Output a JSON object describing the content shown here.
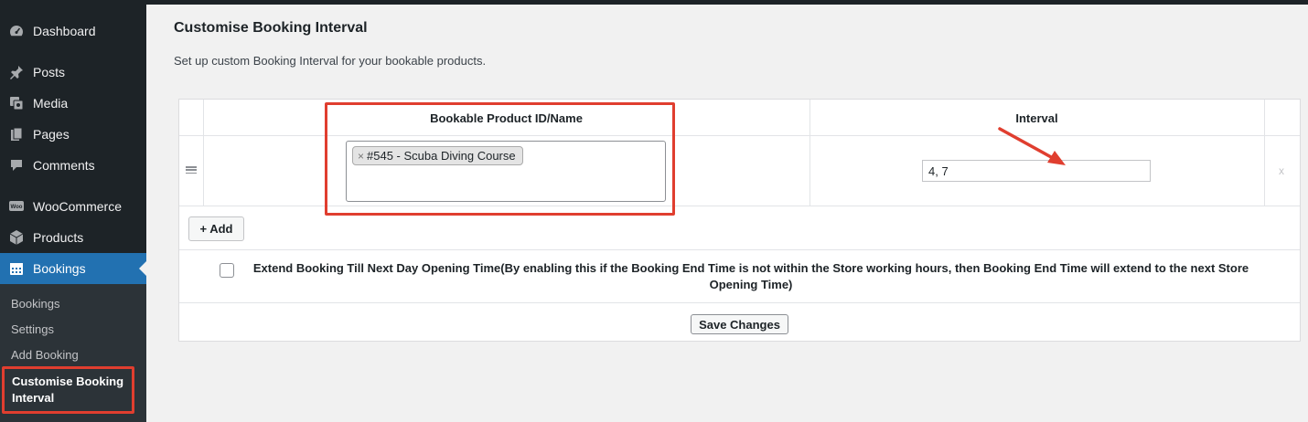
{
  "sidebar": {
    "items": [
      {
        "label": "Dashboard",
        "icon": "dashboard-icon"
      },
      {
        "label": "Posts",
        "icon": "pin-icon"
      },
      {
        "label": "Media",
        "icon": "media-icon"
      },
      {
        "label": "Pages",
        "icon": "pages-icon"
      },
      {
        "label": "Comments",
        "icon": "comment-icon"
      },
      {
        "label": "WooCommerce",
        "icon": "woocommerce-icon"
      },
      {
        "label": "Products",
        "icon": "box-icon"
      },
      {
        "label": "Bookings",
        "icon": "calendar-icon"
      }
    ],
    "submenu": [
      "Bookings",
      "Settings",
      "Add Booking",
      "Customise Booking Interval"
    ],
    "active_color": "#2271b1",
    "highlight_color": "#e03e2f"
  },
  "page": {
    "title": "Customise Booking Interval",
    "description": "Set up custom Booking Interval for your bookable products."
  },
  "table": {
    "columns": [
      "Bookable Product ID/Name",
      "Interval"
    ],
    "rows": [
      {
        "product_chip": "#545 - Scuba Diving Course",
        "chip_remove": "×",
        "interval": "4, 7",
        "remove": "x"
      }
    ]
  },
  "actions": {
    "add_label": "+ Add",
    "extend_label": "Extend Booking Till Next Day Opening Time(By enabling this if the Booking End Time is not within the Store working hours, then Booking End Time will extend to the next Store Opening Time)",
    "extend_checked": false,
    "save_label": "Save Changes"
  }
}
